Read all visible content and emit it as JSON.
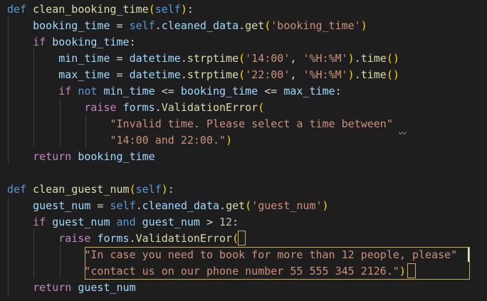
{
  "editor": {
    "lines": [
      [
        [
          "def",
          "kw"
        ],
        [
          " ",
          "op"
        ],
        [
          "clean_booking_time",
          "fn"
        ],
        [
          "(",
          "paren"
        ],
        [
          "self",
          "self"
        ],
        [
          ")",
          "paren"
        ],
        [
          ":",
          "op"
        ]
      ],
      [
        [
          "    ",
          "op"
        ],
        [
          "booking_time",
          "var"
        ],
        [
          " = ",
          "op"
        ],
        [
          "self",
          "self"
        ],
        [
          ".",
          "op"
        ],
        [
          "cleaned_data",
          "var"
        ],
        [
          ".",
          "op"
        ],
        [
          "get",
          "fn"
        ],
        [
          "(",
          "paren"
        ],
        [
          "'booking_time'",
          "str"
        ],
        [
          ")",
          "paren"
        ]
      ],
      [
        [
          "    ",
          "op"
        ],
        [
          "if",
          "ctrl"
        ],
        [
          " ",
          "op"
        ],
        [
          "booking_time",
          "var"
        ],
        [
          ":",
          "op"
        ]
      ],
      [
        [
          "        ",
          "op"
        ],
        [
          "min_time",
          "var"
        ],
        [
          " = ",
          "op"
        ],
        [
          "datetime",
          "var"
        ],
        [
          ".",
          "op"
        ],
        [
          "strptime",
          "fn"
        ],
        [
          "(",
          "paren"
        ],
        [
          "'14:00'",
          "str"
        ],
        [
          ", ",
          "op"
        ],
        [
          "'%H:%M'",
          "str"
        ],
        [
          ")",
          "paren"
        ],
        [
          ".",
          "op"
        ],
        [
          "time",
          "fn"
        ],
        [
          "()",
          "paren"
        ]
      ],
      [
        [
          "        ",
          "op"
        ],
        [
          "max_time",
          "var"
        ],
        [
          " = ",
          "op"
        ],
        [
          "datetime",
          "var"
        ],
        [
          ".",
          "op"
        ],
        [
          "strptime",
          "fn"
        ],
        [
          "(",
          "paren"
        ],
        [
          "'22:00'",
          "str"
        ],
        [
          ", ",
          "op"
        ],
        [
          "'%H:%M'",
          "str"
        ],
        [
          ")",
          "paren"
        ],
        [
          ".",
          "op"
        ],
        [
          "time",
          "fn"
        ],
        [
          "()",
          "paren"
        ]
      ],
      [
        [
          "        ",
          "op"
        ],
        [
          "if",
          "ctrl"
        ],
        [
          " ",
          "op"
        ],
        [
          "not",
          "kw"
        ],
        [
          " ",
          "op"
        ],
        [
          "min_time",
          "var"
        ],
        [
          " <= ",
          "op"
        ],
        [
          "booking_time",
          "var"
        ],
        [
          " <= ",
          "op"
        ],
        [
          "max_time",
          "var"
        ],
        [
          ":",
          "op"
        ]
      ],
      [
        [
          "            ",
          "op"
        ],
        [
          "raise",
          "ctrl"
        ],
        [
          " ",
          "op"
        ],
        [
          "forms",
          "var"
        ],
        [
          ".",
          "op"
        ],
        [
          "ValidationError",
          "fn"
        ],
        [
          "(",
          "paren"
        ]
      ],
      [
        [
          "                ",
          "op"
        ],
        [
          "\"Invalid time. Please select a time between\"",
          "str"
        ]
      ],
      [
        [
          "                ",
          "op"
        ],
        [
          "\"14:00 and 22:00.\"",
          "str"
        ],
        [
          ")",
          "paren"
        ]
      ],
      [
        [
          "    ",
          "op"
        ],
        [
          "return",
          "ctrl"
        ],
        [
          " ",
          "op"
        ],
        [
          "booking_time",
          "var"
        ]
      ],
      [],
      [
        [
          "def",
          "kw"
        ],
        [
          " ",
          "op"
        ],
        [
          "clean_guest_num",
          "fn"
        ],
        [
          "(",
          "paren"
        ],
        [
          "self",
          "self"
        ],
        [
          ")",
          "paren"
        ],
        [
          ":",
          "op"
        ]
      ],
      [
        [
          "    ",
          "op"
        ],
        [
          "guest_num",
          "var"
        ],
        [
          " = ",
          "op"
        ],
        [
          "self",
          "self"
        ],
        [
          ".",
          "op"
        ],
        [
          "cleaned_data",
          "var"
        ],
        [
          ".",
          "op"
        ],
        [
          "get",
          "fn"
        ],
        [
          "(",
          "paren"
        ],
        [
          "'guest_num'",
          "str"
        ],
        [
          ")",
          "paren"
        ]
      ],
      [
        [
          "    ",
          "op"
        ],
        [
          "if",
          "ctrl"
        ],
        [
          " ",
          "op"
        ],
        [
          "guest_num",
          "var"
        ],
        [
          " ",
          "op"
        ],
        [
          "and",
          "kw"
        ],
        [
          " ",
          "op"
        ],
        [
          "guest_num",
          "var"
        ],
        [
          " > ",
          "op"
        ],
        [
          "12",
          "num"
        ],
        [
          ":",
          "op"
        ]
      ],
      [
        [
          "        ",
          "op"
        ],
        [
          "raise",
          "ctrl"
        ],
        [
          " ",
          "op"
        ],
        [
          "forms",
          "var"
        ],
        [
          ".",
          "op"
        ],
        [
          "ValidationError",
          "fn"
        ],
        [
          "(",
          "paren"
        ]
      ],
      [
        [
          "            ",
          "op"
        ],
        [
          "\"In case you need to book for more than 12 people, please\"",
          "str"
        ]
      ],
      [
        [
          "            ",
          "op"
        ],
        [
          "\"contact us on our phone number 55 555 345 2126.\"",
          "str"
        ],
        [
          ")",
          "paren"
        ]
      ],
      [
        [
          "    ",
          "op"
        ],
        [
          "return",
          "ctrl"
        ],
        [
          " ",
          "op"
        ],
        [
          "guest_num",
          "var"
        ]
      ]
    ]
  },
  "colors": {
    "background": "#1e1e1e",
    "keyword": "#569cd6",
    "control": "#c586c0",
    "function": "#dcdcaa",
    "variable": "#9cdcfe",
    "string": "#ce9178",
    "number": "#b5cea8",
    "bracket": "#ffd700"
  }
}
